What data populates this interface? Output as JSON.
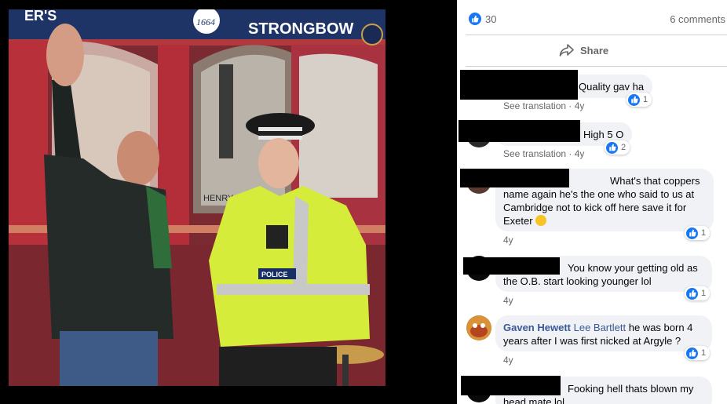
{
  "photo": {
    "signs": {
      "left_fragment": "ER'S",
      "badge": "1664",
      "brand": "STRONGBOW",
      "window_text": "HENRY IS",
      "vest_badge": "POLICE"
    }
  },
  "post_stats": {
    "likes": "30",
    "comments": "6 comments"
  },
  "actions": {
    "share_label": "Share"
  },
  "comments": [
    {
      "author": "",
      "mention": "",
      "text": "Quality gav ha",
      "translation": "See translation",
      "age": "4y",
      "reactions": "1"
    },
    {
      "author": "",
      "mention": "",
      "text": "High 5 O",
      "translation": "See translation",
      "age": "4y",
      "reactions": "2"
    },
    {
      "author": "",
      "mention": "",
      "text": "What's that coppers name again he's the one who said to us at Cambridge not to kick off here save it for Exeter",
      "age": "4y",
      "reactions": "1",
      "emoji": "laughing-face"
    },
    {
      "author": "",
      "mention": "",
      "text": "You know your getting old as the O.B. start looking younger lol",
      "age": "4y",
      "reactions": "1"
    },
    {
      "author": "Gaven Hewett",
      "mention": "Lee Bartlett",
      "text": "he was born 4 years after I was first nicked at Argyle ?",
      "age": "4y",
      "reactions": "1"
    },
    {
      "author": "",
      "mention": "",
      "text": "Fooking hell thats blown my head mate lol"
    }
  ],
  "colors": {
    "facebook_blue": "#1877f2",
    "link_blue": "#385898",
    "meta_gray": "#65676b",
    "bubble_gray": "#f0f2f5",
    "police_yellow": "#d8f03a"
  },
  "icons": [
    "like-icon",
    "share-icon",
    "laughing-emoji-icon"
  ]
}
